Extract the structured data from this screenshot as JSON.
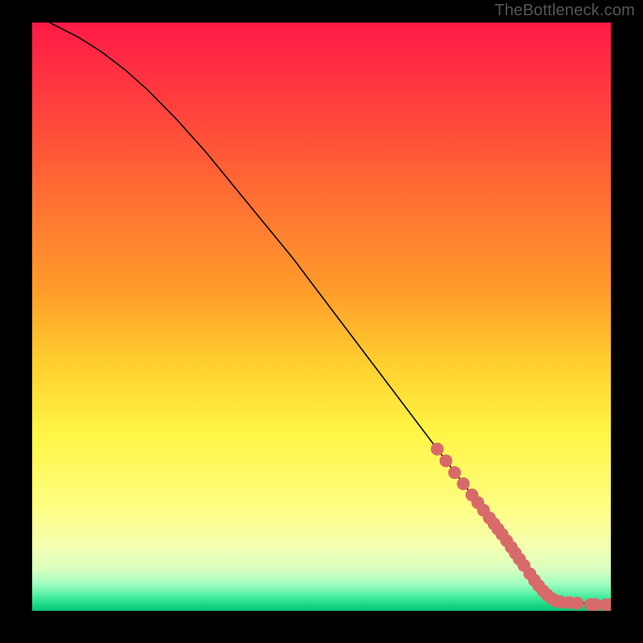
{
  "attribution": "TheBottleneck.com",
  "colors": {
    "bg_black": "#000000",
    "curve": "#000000",
    "marker_fill": "#d86a6a",
    "marker_stroke": "#b85555",
    "gradient_stops": [
      {
        "pos": 0.0,
        "color": "#ff1a47"
      },
      {
        "pos": 0.12,
        "color": "#ff3a3f"
      },
      {
        "pos": 0.28,
        "color": "#ff6a33"
      },
      {
        "pos": 0.45,
        "color": "#ff9a2a"
      },
      {
        "pos": 0.58,
        "color": "#ffcf2e"
      },
      {
        "pos": 0.7,
        "color": "#fff646"
      },
      {
        "pos": 0.82,
        "color": "#fffe80"
      },
      {
        "pos": 0.89,
        "color": "#f4ffb0"
      },
      {
        "pos": 0.93,
        "color": "#d8ffc0"
      },
      {
        "pos": 0.955,
        "color": "#9efec0"
      },
      {
        "pos": 0.975,
        "color": "#4ceda0"
      },
      {
        "pos": 0.99,
        "color": "#18d884"
      },
      {
        "pos": 1.0,
        "color": "#07c274"
      }
    ]
  },
  "chart_data": {
    "type": "line",
    "title": "",
    "xlabel": "",
    "ylabel": "",
    "xlim": [
      0,
      100
    ],
    "ylim": [
      0,
      100
    ],
    "series": [
      {
        "name": "curve",
        "x": [
          3,
          5,
          8,
          12,
          16,
          20,
          25,
          30,
          35,
          40,
          45,
          50,
          55,
          60,
          65,
          70,
          75,
          80,
          84,
          87,
          89,
          91,
          93,
          96,
          100
        ],
        "y": [
          100,
          99,
          97.5,
          95,
          92,
          88.5,
          83.5,
          78,
          72,
          66,
          60,
          53.5,
          47,
          40.5,
          34,
          27.5,
          21,
          14.5,
          9,
          5.5,
          3.5,
          2.2,
          1.5,
          1.2,
          1
        ]
      }
    ],
    "markers": {
      "name": "bottleneck-points",
      "color": "#d86a6a",
      "radius_px": 8,
      "points": [
        {
          "x": 70,
          "y": 27.5
        },
        {
          "x": 71.5,
          "y": 25.5
        },
        {
          "x": 73,
          "y": 23.5
        },
        {
          "x": 74.5,
          "y": 21.6
        },
        {
          "x": 76,
          "y": 19.7
        },
        {
          "x": 77,
          "y": 18.4
        },
        {
          "x": 78,
          "y": 17.1
        },
        {
          "x": 79,
          "y": 15.8
        },
        {
          "x": 79.8,
          "y": 14.8
        },
        {
          "x": 80.5,
          "y": 13.9
        },
        {
          "x": 81.2,
          "y": 13.0
        },
        {
          "x": 82.0,
          "y": 11.9
        },
        {
          "x": 82.8,
          "y": 10.8
        },
        {
          "x": 83.5,
          "y": 9.8
        },
        {
          "x": 84.2,
          "y": 8.8
        },
        {
          "x": 85.0,
          "y": 7.7
        },
        {
          "x": 86.0,
          "y": 6.3
        },
        {
          "x": 86.8,
          "y": 5.2
        },
        {
          "x": 87.5,
          "y": 4.3
        },
        {
          "x": 88.3,
          "y": 3.4
        },
        {
          "x": 89.0,
          "y": 2.7
        },
        {
          "x": 89.8,
          "y": 2.1
        },
        {
          "x": 90.5,
          "y": 1.7
        },
        {
          "x": 91.3,
          "y": 1.5
        },
        {
          "x": 92.8,
          "y": 1.4
        },
        {
          "x": 94.2,
          "y": 1.3
        },
        {
          "x": 96.5,
          "y": 1.1
        },
        {
          "x": 97.3,
          "y": 1.05
        },
        {
          "x": 99.1,
          "y": 1.0
        },
        {
          "x": 99.8,
          "y": 1.0
        }
      ]
    }
  }
}
